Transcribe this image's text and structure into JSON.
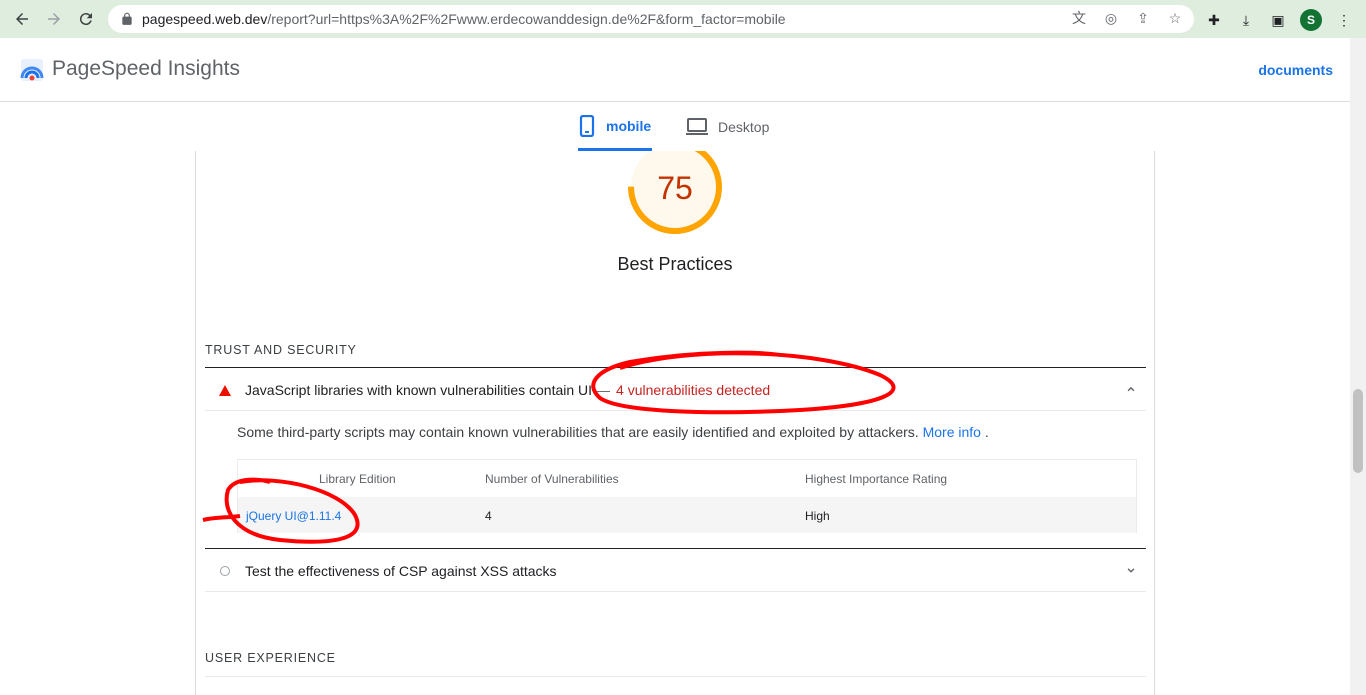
{
  "browser": {
    "url_host": "pagespeed.web.dev",
    "url_rest": "/report?url=https%3A%2F%2Fwww.erdecowanddesign.de%2F&form_factor=mobile",
    "profile_initial": "S"
  },
  "header": {
    "brand": "PageSpeed Insights",
    "docs_link": "documents"
  },
  "tabs": [
    {
      "label": "mobile",
      "icon": "phone-icon",
      "active": true
    },
    {
      "label": "Desktop",
      "icon": "laptop-icon",
      "active": false
    }
  ],
  "score": {
    "value": "75",
    "title": "Best Practices",
    "color": "#ffa400"
  },
  "sections": {
    "trust": "TRUST AND SECURITY",
    "ux": "USER EXPERIENCE"
  },
  "audit_vuln": {
    "title": "JavaScript libraries with known vulnerabilities contain UI",
    "separator": "—",
    "detail": "4 vulnerabilities detected",
    "description": "Some third-party scripts may contain known vulnerabilities that are easily identified and exploited by attackers.",
    "more_info": "More info",
    "period": "."
  },
  "vuln_table": {
    "headers": [
      "Library Edition",
      "Number of Vulnerabilities",
      "Highest Importance Rating"
    ],
    "rows": [
      [
        "jQuery UI@1.11.4",
        "4",
        "High"
      ]
    ]
  },
  "audit_csp": {
    "title": "Test the effectiveness of CSP against XSS attacks"
  },
  "colors": {
    "fail_red": "#c5221f",
    "link_blue": "#1a73e8",
    "annotation_red": "#ff0000"
  }
}
